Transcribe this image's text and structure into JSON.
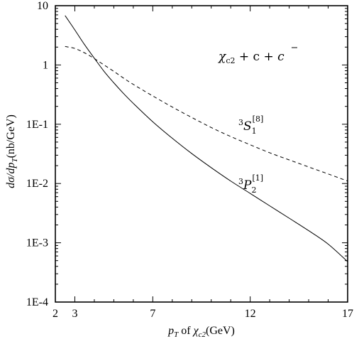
{
  "chart_data": {
    "type": "line",
    "xlabel": {
      "pre": "p",
      "pre_sub": "T",
      "mid": " of ",
      "chi": "χ",
      "chi_sub": "c2",
      "post": "(GeV)"
    },
    "ylabel": {
      "pre": "dσ/dp",
      "pre_sub": "T",
      "post": "(nb/GeV)"
    },
    "xlim": [
      2,
      17
    ],
    "ylim": [
      0.0001,
      10
    ],
    "y_scale": "log",
    "grid": false,
    "x_ticks": [
      {
        "value": 2,
        "label": "2"
      },
      {
        "value": 3,
        "label": "3"
      },
      {
        "value": 7,
        "label": "7"
      },
      {
        "value": 12,
        "label": "12"
      },
      {
        "value": 17,
        "label": "17"
      }
    ],
    "y_ticks": [
      {
        "value": 10,
        "label": "10"
      },
      {
        "value": 1,
        "label": "1"
      },
      {
        "value": 0.1,
        "label": "1E-1"
      },
      {
        "value": 0.01,
        "label": "1E-2"
      },
      {
        "value": 0.001,
        "label": "1E-3"
      },
      {
        "value": 0.0001,
        "label": "1E-4"
      }
    ],
    "process_label": {
      "chi": "χ",
      "chi_sub": "c2",
      "rest": " + c + ",
      "cbar": "c"
    },
    "series": [
      {
        "label": {
          "pre_sup": "3",
          "main": "P",
          "sub": "2",
          "sup": "[1]"
        },
        "style": "solid",
        "x": [
          2.5,
          3,
          3.5,
          4,
          4.5,
          5,
          5.5,
          6,
          7,
          8,
          9,
          10,
          11,
          12,
          13,
          14,
          15,
          16,
          17
        ],
        "y": [
          6.8,
          3.9,
          2.2,
          1.3,
          0.78,
          0.5,
          0.33,
          0.225,
          0.11,
          0.058,
          0.032,
          0.0185,
          0.011,
          0.0068,
          0.0042,
          0.0026,
          0.0016,
          0.00095,
          0.00048
        ]
      },
      {
        "label": {
          "pre_sup": "3",
          "main": "S",
          "sub": "1",
          "sup": "[8]"
        },
        "style": "dashed",
        "x": [
          2.5,
          3,
          3.5,
          4,
          4.5,
          5,
          5.5,
          6,
          7,
          8,
          9,
          10,
          11,
          12,
          13,
          14,
          15,
          16,
          17
        ],
        "y": [
          2.05,
          1.9,
          1.6,
          1.28,
          1.0,
          0.78,
          0.6,
          0.47,
          0.3,
          0.195,
          0.13,
          0.088,
          0.062,
          0.045,
          0.033,
          0.025,
          0.019,
          0.0145,
          0.011
        ]
      }
    ]
  }
}
